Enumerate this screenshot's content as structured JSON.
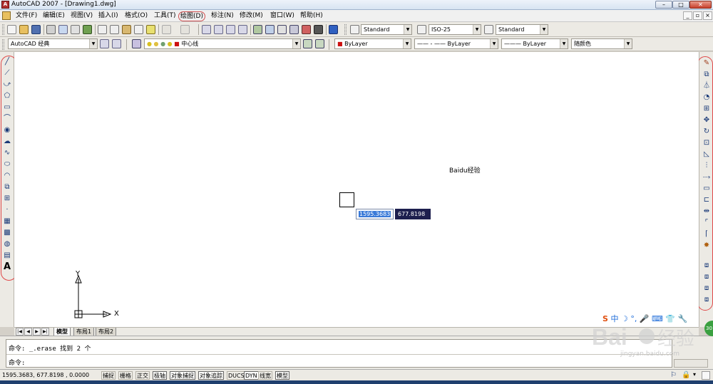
{
  "window": {
    "title": "AutoCAD 2007 - [Drawing1.dwg]",
    "min": "–",
    "max": "□",
    "close": "✕"
  },
  "menu": {
    "items": [
      "文件(F)",
      "编辑(E)",
      "视图(V)",
      "插入(I)",
      "格式(O)",
      "工具(T)",
      "绘图(D)",
      "标注(N)",
      "修改(M)",
      "窗口(W)",
      "帮助(H)"
    ],
    "highlighted": "绘图(D)",
    "doc_controls": [
      "_",
      "▫",
      "×"
    ]
  },
  "toolbar_styles": {
    "text_style": "Standard",
    "dim_style": "ISO-25",
    "table_style": "Standard"
  },
  "toolbar_layers": {
    "workspace": "AutoCAD 经典",
    "layer_name": "中心线",
    "color": "ByLayer",
    "linetype": "ByLayer",
    "lineweight": "ByLayer",
    "plotstyle": "随颜色"
  },
  "canvas": {
    "background": "#ffffff",
    "dyn_x": "1595.3683",
    "dyn_y": "677.8198",
    "ucs_x_label": "X",
    "ucs_y_label": "Y"
  },
  "layout_tabs": [
    "模型",
    "布局1",
    "布局2"
  ],
  "command": {
    "line1": "命令: _.erase 找到 2 个",
    "line2": "命令:"
  },
  "status": {
    "coords": "1595.3683, 677.8198 , 0.0000",
    "buttons": [
      "捕捉",
      "栅格",
      "正交",
      "极轴",
      "对象捕捉",
      "对象追踪",
      "DUCS",
      "DYN",
      "线宽",
      "模型"
    ]
  },
  "watermark": {
    "brand": "Baidu经验",
    "url": "jingyan.baidu.com"
  },
  "colors": {
    "accent_red": "#e04848",
    "dyn_dark": "#1d1f4e",
    "dyn_highlight": "#3a7ad8"
  }
}
